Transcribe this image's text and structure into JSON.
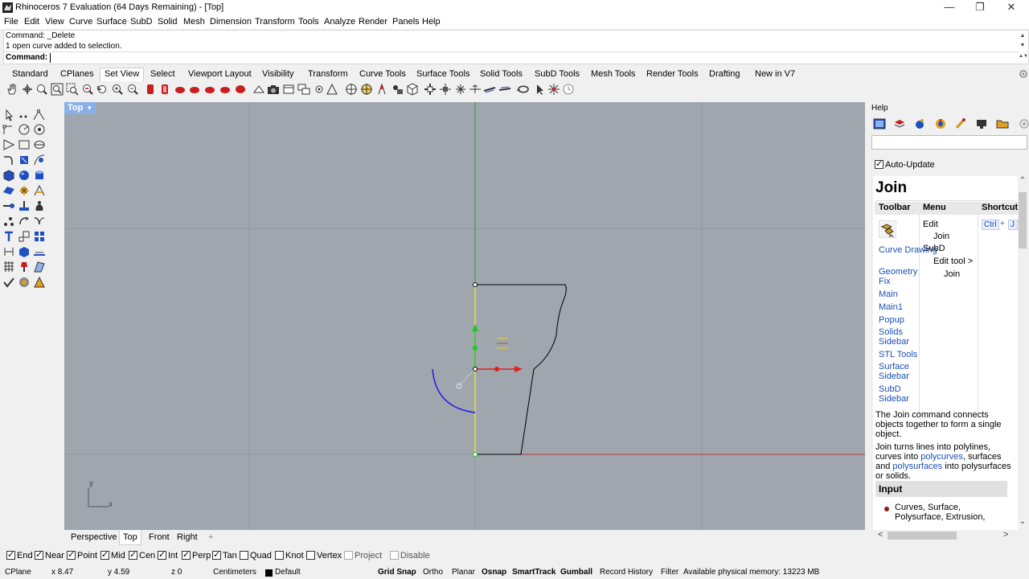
{
  "window": {
    "title": "Rhinoceros 7 Evaluation (64 Days Remaining) - [Top]",
    "minimize": "—",
    "restore": "❐",
    "close": "✕"
  },
  "menu": [
    "File",
    "Edit",
    "View",
    "Curve",
    "Surface",
    "SubD",
    "Solid",
    "Mesh",
    "Dimension",
    "Transform",
    "Tools",
    "Analyze",
    "Render",
    "Panels",
    "Help"
  ],
  "command": {
    "history": [
      "Command: _Delete",
      "1 open curve added to selection."
    ],
    "prompt": "Command:",
    "scroll_up": "▲",
    "scroll_down": "▼",
    "scroll_more": "▲▼"
  },
  "toolbar_tabs": {
    "items": [
      "Standard",
      "CPlanes",
      "Set View",
      "Select",
      "Viewport Layout",
      "Visibility",
      "Transform",
      "Curve Tools",
      "Surface Tools",
      "Solid Tools",
      "SubD Tools",
      "Mesh Tools",
      "Render Tools",
      "Drafting",
      "New in V7"
    ],
    "active": "Set View"
  },
  "viewport": {
    "label": "Top",
    "dropdown": "▼",
    "axis_y": "y",
    "axis_x": "x",
    "colors": {
      "background": "#9fa6ae",
      "x_axis": "#b43c3c",
      "y_axis": "#3c9a3c",
      "grid": "#8e959d",
      "curve": "#000000",
      "arc": "#1a1ae6",
      "selected": "#e6e61a"
    }
  },
  "viewport_tabs": {
    "items": [
      "Perspective",
      "Top",
      "Front",
      "Right"
    ],
    "add": "+",
    "active": "Top"
  },
  "osnaps": [
    {
      "label": "End",
      "checked": true
    },
    {
      "label": "Near",
      "checked": true
    },
    {
      "label": "Point",
      "checked": true
    },
    {
      "label": "Mid",
      "checked": true
    },
    {
      "label": "Cen",
      "checked": true
    },
    {
      "label": "Int",
      "checked": true
    },
    {
      "label": "Perp",
      "checked": true
    },
    {
      "label": "Tan",
      "checked": true
    },
    {
      "label": "Quad",
      "checked": false
    },
    {
      "label": "Knot",
      "checked": false
    },
    {
      "label": "Vertex",
      "checked": false
    },
    {
      "label": "Project",
      "checked": false
    },
    {
      "label": "Disable",
      "checked": false
    }
  ],
  "status": {
    "cplane": "CPlane",
    "x": "x 8.47",
    "y": "y 4.59",
    "z": "z 0",
    "units": "Centimeters",
    "layer": "Default",
    "grid_snap": "Grid Snap",
    "ortho": "Ortho",
    "planar": "Planar",
    "osnap": "Osnap",
    "smarttrack": "SmartTrack",
    "gumball": "Gumball",
    "record_history": "Record History",
    "filter": "Filter",
    "memory": "Available physical memory: 13223 MB"
  },
  "help": {
    "panel_title": "Help",
    "auto_update": "Auto-Update",
    "command_name": "Join",
    "col_toolbar": "Toolbar",
    "col_menu": "Menu",
    "col_shortcut": "Shortcut",
    "toolbars": [
      "Curve Drawing",
      "Geometry Fix",
      "Main",
      "Main1",
      "Popup",
      "Solids Sidebar",
      "STL Tools",
      "Surface Sidebar",
      "SubD Sidebar"
    ],
    "menu_lines": [
      "Edit",
      "Join",
      "SubD",
      "Edit tool >",
      "Join"
    ],
    "shortcut_key": "Ctrl",
    "shortcut_plus": "+",
    "shortcut_key2": "J",
    "desc1": "The Join command connects objects together to form a single object.",
    "desc2_a": "Join turns lines into polylines, curves into ",
    "desc2_link1": "polycurves",
    "desc2_b": ", surfaces and ",
    "desc2_link2": "polysurfaces",
    "desc2_c": " into polysurfaces or solids.",
    "input_heading": "Input",
    "input_item": "Curves, Surface, Polysurface, Extrusion,",
    "scroll_up": "⌃",
    "scroll_down": "⌄",
    "scroll_left": "<",
    "scroll_right": ">"
  }
}
